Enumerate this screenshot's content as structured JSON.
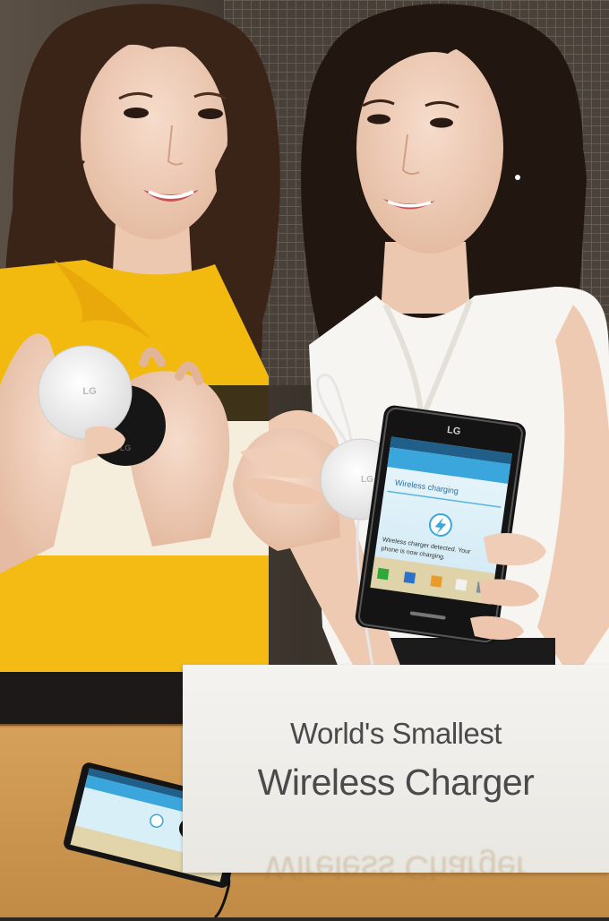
{
  "sign": {
    "line1": "World's Smallest",
    "line2": "Wireless Charger"
  },
  "brand": {
    "logo_text": "LG"
  },
  "phone_screen": {
    "header": "Wireless charging",
    "message_line1": "Wireless charger detected. Your",
    "message_line2": "phone is now charging."
  },
  "colors": {
    "sweater_yellow": "#f2b90f",
    "charger_white": "#f2f2f2",
    "charger_black": "#161616",
    "table_wood": "#d9a55c",
    "screen_accent": "#3aa6dc"
  }
}
